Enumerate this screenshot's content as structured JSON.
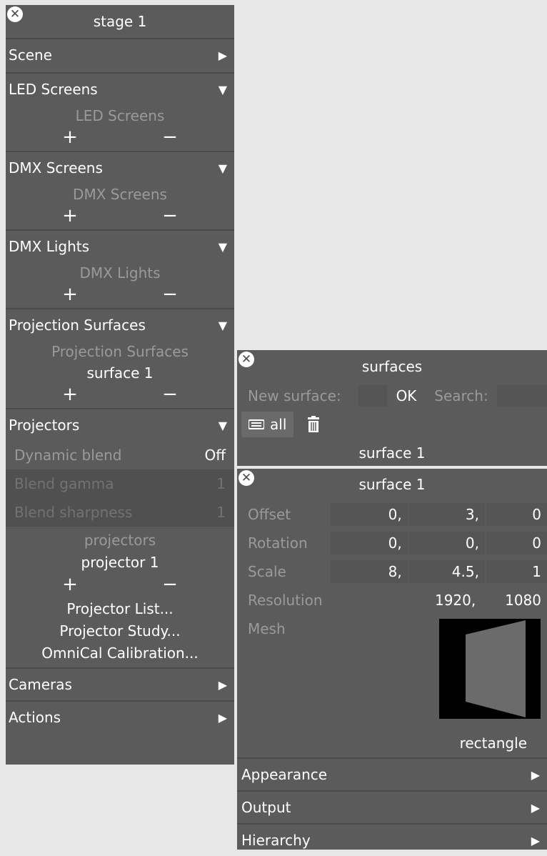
{
  "stage": {
    "title": "stage 1",
    "sections": {
      "scene": {
        "label": "Scene",
        "arrow": "▶"
      },
      "led": {
        "label": "LED Screens",
        "arrow": "▼",
        "list_title": "LED Screens"
      },
      "dmx_screens": {
        "label": "DMX Screens",
        "arrow": "▼",
        "list_title": "DMX Screens"
      },
      "dmx_lights": {
        "label": "DMX Lights",
        "arrow": "▼",
        "list_title": "DMX Lights"
      },
      "surfaces": {
        "label": "Projection Surfaces",
        "arrow": "▼",
        "list_title": "Projection Surfaces",
        "item": "surface 1"
      },
      "projectors": {
        "label": "Projectors",
        "arrow": "▼",
        "dynamic_blend_label": "Dynamic blend",
        "dynamic_blend_value": "Off",
        "blend_gamma_label": "Blend gamma",
        "blend_gamma_value": "1",
        "blend_sharpness_label": "Blend sharpness",
        "blend_sharpness_value": "1",
        "list_title": "projectors",
        "item": "projector 1",
        "projector_list": "Projector List...",
        "projector_study": "Projector Study...",
        "omnical": "OmniCal Calibration..."
      },
      "cameras": {
        "label": "Cameras",
        "arrow": "▶"
      },
      "actions": {
        "label": "Actions",
        "arrow": "▶"
      }
    },
    "plus": "+",
    "minus": "−"
  },
  "surfaces_panel": {
    "title": "surfaces",
    "new_surface_label": "New surface:",
    "ok_label": "OK",
    "search_label": "Search:",
    "all_label": "all",
    "item": "surface 1"
  },
  "surface_panel": {
    "title": "surface 1",
    "offset": {
      "label": "Offset",
      "x": "0,",
      "y": "3,",
      "z": "0"
    },
    "rotation": {
      "label": "Rotation",
      "x": "0,",
      "y": "0,",
      "z": "0"
    },
    "scale": {
      "label": "Scale",
      "x": "8,",
      "y": "4.5,",
      "z": "1"
    },
    "resolution": {
      "label": "Resolution",
      "w": "1920,",
      "h": "1080"
    },
    "mesh_label": "Mesh",
    "mesh_value": "rectangle",
    "appearance": "Appearance",
    "output": "Output",
    "hierarchy": "Hierarchy",
    "arrow": "▶"
  },
  "colors": {
    "panel_bg": "#5b5b5b",
    "desktop_bg": "#e7e7e7",
    "muted_text": "#9a9a9a"
  },
  "icons": [
    "close-icon",
    "triangle-right-icon",
    "triangle-down-icon",
    "list-icon",
    "trash-icon"
  ]
}
